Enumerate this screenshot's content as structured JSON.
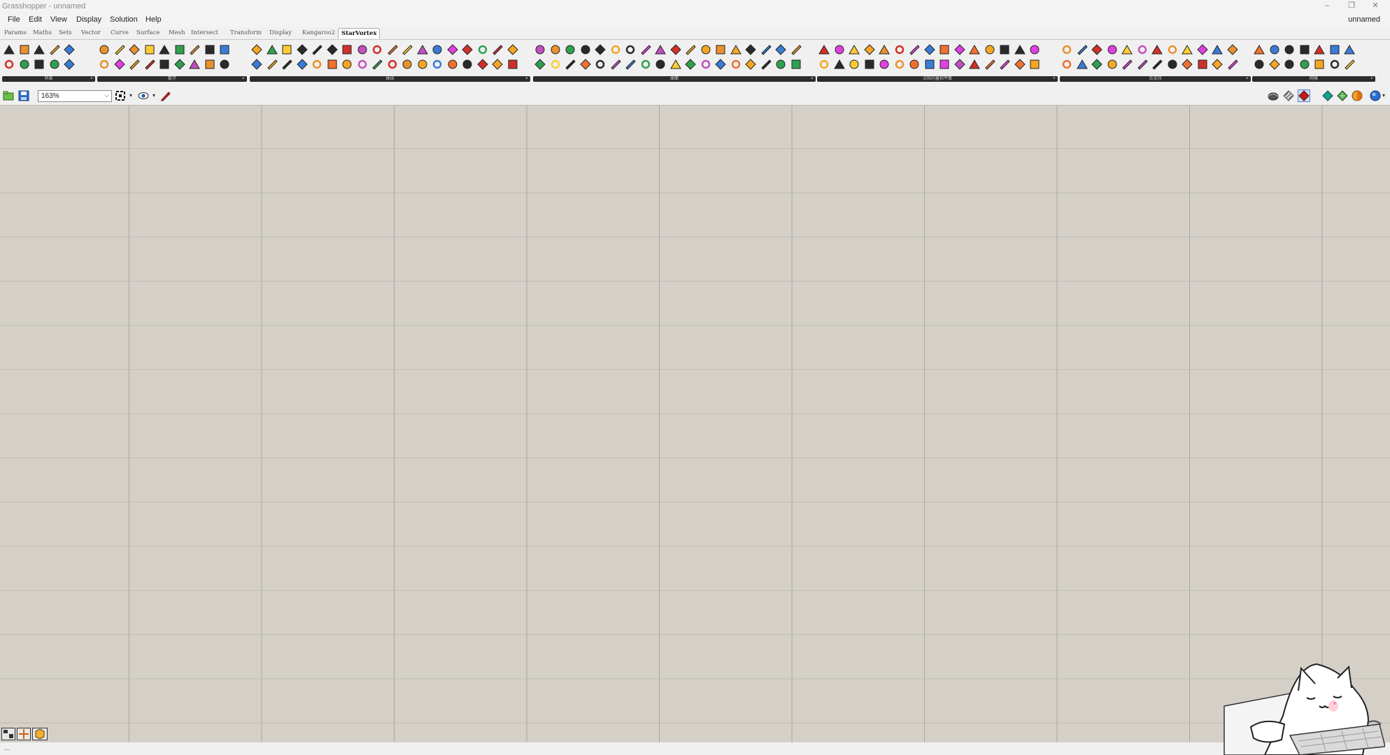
{
  "window": {
    "title": "Grasshopper - unnamed",
    "doc_name": "unnamed",
    "buttons": {
      "minimize": "–",
      "restore": "❐",
      "close": "✕"
    }
  },
  "menu": [
    "File",
    "Edit",
    "View",
    "Display",
    "Solution",
    "Help"
  ],
  "tabs": [
    "Params",
    "Maths",
    "Sets",
    "Vector",
    "Curve",
    "Surface",
    "Mesh",
    "Intersect",
    "Transform",
    "Display",
    "Kangaroo2",
    "StarVortex"
  ],
  "active_tab": "StarVortex",
  "ribbon_groups": [
    {
      "label": "列表"
    },
    {
      "label": "数学"
    },
    {
      "label": "曲线"
    },
    {
      "label": "曲面"
    },
    {
      "label": "点和向量和平面"
    },
    {
      "label": "合支持"
    },
    {
      "label": "网格"
    }
  ],
  "canvas_toolbar": {
    "zoom": "163%",
    "icons": [
      "open-file-icon",
      "save-icon",
      "zoom-extents-icon",
      "preview-eye-icon",
      "sketch-pen-icon"
    ],
    "right_icons": [
      "preview-wire-icon",
      "preview-off-icon",
      "preview-shaded-icon",
      "preview-selected-icon",
      "preview-mesh-icon",
      "preview-render-icon",
      "sphere-icon"
    ]
  },
  "status": {
    "text": "..."
  },
  "colors": {
    "canvas": "#d4d0c8",
    "grid": "#a8a59f",
    "accent_orange": "#f5a623",
    "accent_red": "#d0302a",
    "accent_pink": "#e040e0"
  }
}
